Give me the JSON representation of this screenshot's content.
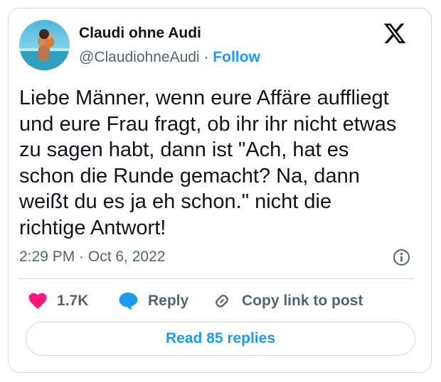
{
  "author": {
    "display_name": "Claudi ohne Audi",
    "handle": "@ClaudiohneAudi",
    "separator": "·",
    "follow_label": "Follow",
    "avatar_icon": "profile-photo-beach"
  },
  "brand": {
    "logo_icon": "x-logo-icon"
  },
  "tweet": {
    "text": "Liebe Männer, wenn eure Affäre auffliegt\nund eure Frau fragt, ob ihr ihr nicht etwas\nzu sagen habt, dann ist \"Ach, hat es\nschon die Runde gemacht? Na, dann\nweißt du es ja eh schon.\" nicht die\nrichtige Antwort!",
    "timestamp": "2:29 PM · Oct 6, 2022"
  },
  "actions": {
    "likes_count": "1.7K",
    "reply_label": "Reply",
    "copy_link_label": "Copy link to post"
  },
  "footer": {
    "read_replies_label": "Read 85 replies"
  },
  "colors": {
    "accent": "#1d9bf0",
    "like": "#f91880",
    "secondary_text": "#536471",
    "border": "#cfd9de"
  }
}
